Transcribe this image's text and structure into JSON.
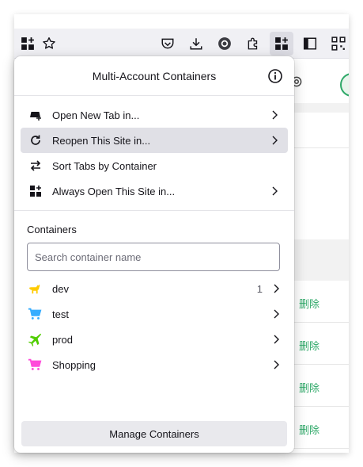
{
  "panel": {
    "title": "Multi-Account Containers",
    "menu": [
      {
        "label": "Open New Tab in...",
        "icon": "new-tab-icon",
        "chevron": true
      },
      {
        "label": "Reopen This Site in...",
        "icon": "reopen-icon",
        "chevron": true
      },
      {
        "label": "Sort Tabs by Container",
        "icon": "sort-icon",
        "chevron": false
      },
      {
        "label": "Always Open This Site in...",
        "icon": "always-open-icon",
        "chevron": true
      }
    ],
    "containers_title": "Containers",
    "search_placeholder": "Search container name",
    "containers": [
      {
        "name": "dev",
        "count": "1",
        "icon": "dog-icon",
        "color": "#ffcb00"
      },
      {
        "name": "test",
        "count": "",
        "icon": "cart-icon",
        "color": "#37adff"
      },
      {
        "name": "prod",
        "count": "",
        "icon": "airplane-icon",
        "color": "#51cd00"
      },
      {
        "name": "Shopping",
        "count": "",
        "icon": "cart-icon",
        "color": "#ff4bda"
      }
    ],
    "manage_label": "Manage Containers"
  },
  "page": {
    "delete_links": [
      "删除",
      "删除",
      "删除",
      "删除"
    ]
  },
  "colors": {
    "accent_link": "#2ea868",
    "hover_bg": "#e0e0e6"
  }
}
